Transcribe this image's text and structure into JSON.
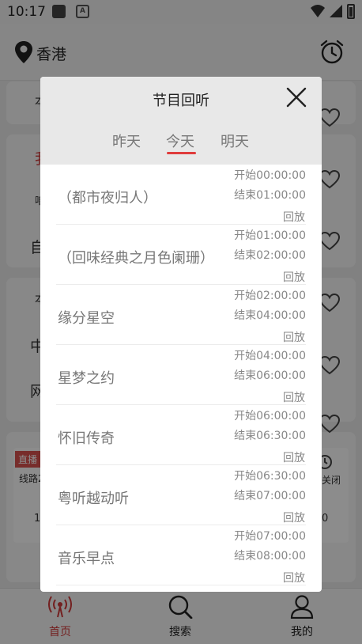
{
  "status_bar": {
    "time": "10:17",
    "notif_letter": "A"
  },
  "app_bar": {
    "city": "香港"
  },
  "background": {
    "card_lines": [
      "本",
      "我",
      "咱",
      "自",
      "本",
      "中",
      "网"
    ],
    "live_tag": "直播",
    "route": "线路2",
    "number_left": "1",
    "close_label": "关闭",
    "number_right": "0"
  },
  "bottom_nav": [
    {
      "label": "首页",
      "icon": "radio-icon"
    },
    {
      "label": "搜索",
      "icon": "search-icon"
    },
    {
      "label": "我的",
      "icon": "user-icon"
    }
  ],
  "modal": {
    "title": "节目回听",
    "tabs": [
      "昨天",
      "今天",
      "明天"
    ],
    "active_tab": "今天",
    "programs": [
      {
        "name": "（都市夜归人）",
        "start": "开始00:00:00",
        "end": "结束01:00:00",
        "action": "回放"
      },
      {
        "name": "（回味经典之月色阑珊）",
        "start": "开始01:00:00",
        "end": "结束02:00:00",
        "action": "回放"
      },
      {
        "name": "缘分星空",
        "start": "开始02:00:00",
        "end": "结束04:00:00",
        "action": "回放"
      },
      {
        "name": "星梦之约",
        "start": "开始04:00:00",
        "end": "结束06:00:00",
        "action": "回放"
      },
      {
        "name": "怀旧传奇",
        "start": "开始06:00:00",
        "end": "结束06:30:00",
        "action": "回放"
      },
      {
        "name": "粤听越动听",
        "start": "开始06:30:00",
        "end": "结束07:00:00",
        "action": "回放"
      },
      {
        "name": "音乐早点",
        "start": "开始07:00:00",
        "end": "结束08:00:00",
        "action": "回放"
      }
    ]
  },
  "colors": {
    "accent": "#e03c3c",
    "overlay": "rgba(0,0,0,0.45)",
    "header_bg": "#e8e8e8"
  }
}
